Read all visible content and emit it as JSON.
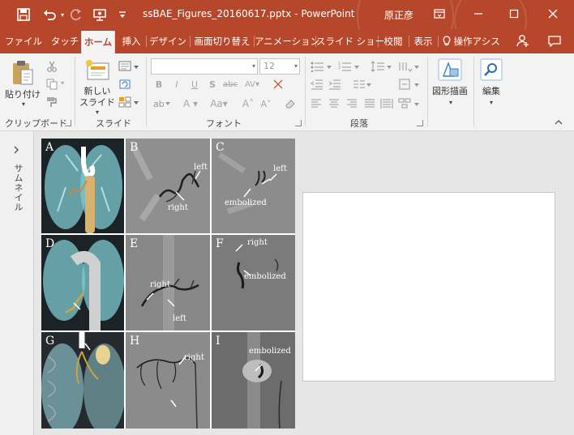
{
  "titlebar": {
    "file_name": "ssBAE_Figures_20160617.pptx",
    "separator": "-",
    "app_name": "PowerPoint",
    "user": "原正彦",
    "icons": [
      "save-icon",
      "undo-icon",
      "redo-icon",
      "present-icon",
      "customize-qat-icon",
      "ribbon-display-icon",
      "minimize-icon",
      "maximize-icon",
      "close-icon"
    ]
  },
  "tabs": [
    "ファイル",
    "タッチ",
    "ホーム",
    "挿入",
    "デザイン",
    "画面切り替え",
    "アニメーション",
    "スライド ショー",
    "校閲",
    "表示",
    "操作アシス"
  ],
  "active_tab": "ホーム",
  "ribbon": {
    "clipboard": {
      "paste": "貼り付け",
      "label": "クリップボード"
    },
    "slides": {
      "new_slide_line1": "新しい",
      "new_slide_line2": "スライド",
      "label": "スライド"
    },
    "font": {
      "font_name": "",
      "font_size": "12",
      "label": "フォント"
    },
    "paragraph": {
      "label": "段落"
    },
    "drawing": {
      "label": "図形描画"
    },
    "editing": {
      "label": "編集"
    }
  },
  "thumbnail_pane": {
    "label": "サムネイル"
  },
  "figure": {
    "panels": [
      {
        "id": "A",
        "annotations": []
      },
      {
        "id": "B",
        "annotations": [
          "left",
          "right"
        ]
      },
      {
        "id": "C",
        "annotations": [
          "left",
          "embolized"
        ]
      },
      {
        "id": "D",
        "annotations": []
      },
      {
        "id": "E",
        "annotations": [
          "right",
          "left"
        ]
      },
      {
        "id": "F",
        "annotations": [
          "right",
          "embolized"
        ]
      },
      {
        "id": "G",
        "annotations": []
      },
      {
        "id": "H",
        "annotations": [
          "right"
        ]
      },
      {
        "id": "I",
        "annotations": [
          "embolized"
        ]
      }
    ]
  },
  "colors": {
    "accent": "#b7472a",
    "ribbon_bg": "#f3f3f3",
    "work_bg": "#e6e6e6"
  }
}
